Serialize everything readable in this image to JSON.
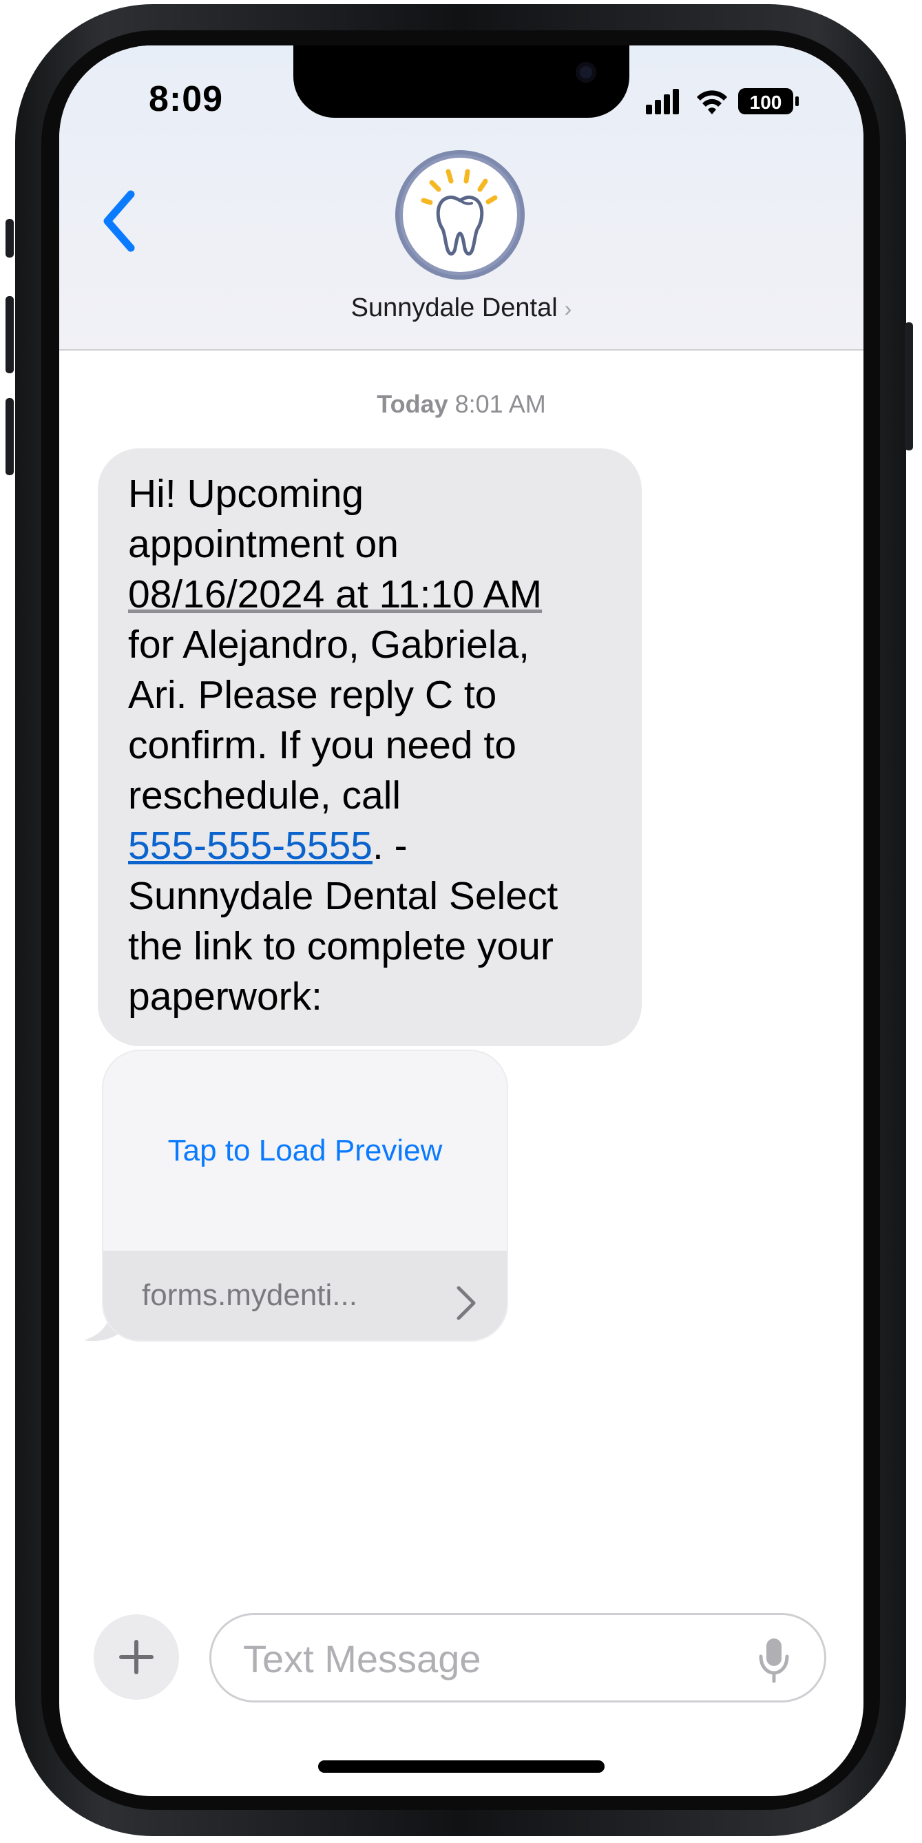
{
  "status_bar": {
    "time": "8:09",
    "battery": "100",
    "icons": [
      "cellular-signal-icon",
      "wifi-icon",
      "battery-icon"
    ]
  },
  "header": {
    "back_icon": "chevron-left-icon",
    "contact_name": "Sunnydale Dental",
    "avatar_icon": "tooth-icon"
  },
  "conversation": {
    "timestamp_day": "Today",
    "timestamp_time": "8:01 AM",
    "message": {
      "line1": "Hi! Upcoming",
      "line2": "appointment on",
      "date_link": "08/16/2024 at 11:10 AM",
      "line4": "for Alejandro, Gabriela,",
      "line5": "Ari.  Please reply C to",
      "line6": "confirm. If you need to",
      "line7": "reschedule, call",
      "phone": "555-555-5555",
      "after_phone": ". -",
      "line9": "Sunnydale Dental Select",
      "line10": "the link to complete your",
      "line11": "paperwork:"
    },
    "link_preview": {
      "action": "Tap to Load Preview",
      "url": "forms.mydenti..."
    }
  },
  "compose": {
    "placeholder": "Text Message",
    "value": ""
  },
  "colors": {
    "link": "#0a7aff",
    "bubble": "#e9e9eb",
    "header": "#eef1f7",
    "avatar_ring": "#7e8aad",
    "tooth_rays": "#f5b823"
  }
}
